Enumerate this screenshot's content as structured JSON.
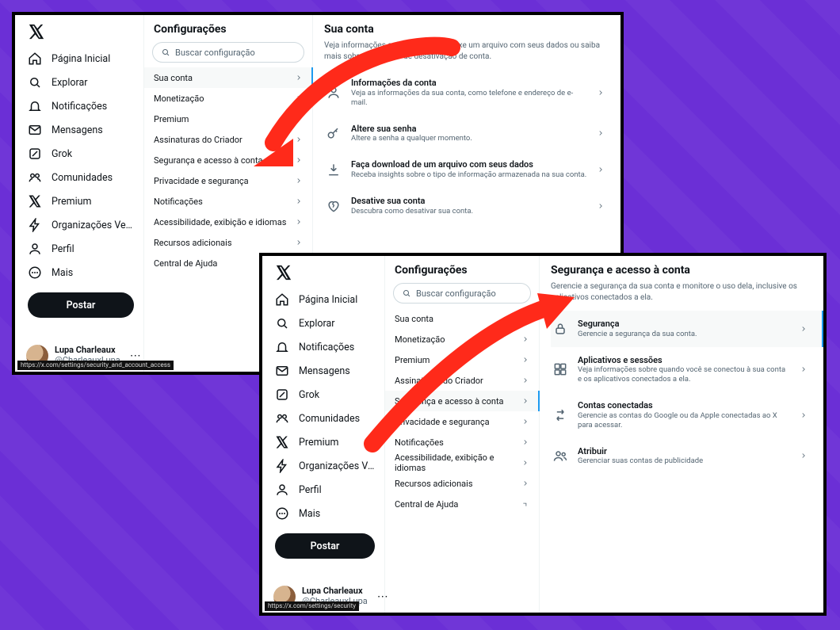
{
  "shared": {
    "nav": {
      "items": [
        {
          "id": "home",
          "label": "Página Inicial"
        },
        {
          "id": "explore",
          "label": "Explorar"
        },
        {
          "id": "notifications",
          "label": "Notificações"
        },
        {
          "id": "messages",
          "label": "Mensagens"
        },
        {
          "id": "grok",
          "label": "Grok"
        },
        {
          "id": "communities",
          "label": "Comunidades"
        },
        {
          "id": "premium",
          "label": "Premium"
        },
        {
          "id": "orgs",
          "label": "Organizações Verific"
        },
        {
          "id": "profile",
          "label": "Perfil"
        },
        {
          "id": "more",
          "label": "Mais"
        }
      ],
      "post_label": "Postar"
    },
    "profile": {
      "name": "Lupa Charleaux",
      "handle": "@CharleauxLupa"
    },
    "settings_header": "Configurações",
    "search_placeholder": "Buscar configuração",
    "settings_items": [
      {
        "id": "account",
        "label": "Sua conta"
      },
      {
        "id": "monetization",
        "label": "Monetização"
      },
      {
        "id": "premium",
        "label": "Premium"
      },
      {
        "id": "creator",
        "label": "Assinaturas do Criador"
      },
      {
        "id": "security",
        "label": "Segurança e acesso à conta"
      },
      {
        "id": "privacy",
        "label": "Privacidade e segurança"
      },
      {
        "id": "notif",
        "label": "Notificações"
      },
      {
        "id": "a11y",
        "label": "Acessibilidade, exibição e idiomas"
      },
      {
        "id": "extra",
        "label": "Recursos adicionais"
      },
      {
        "id": "help",
        "label": "Central de Ajuda",
        "ext": true
      }
    ]
  },
  "shot1": {
    "url": "https://x.com/settings/security_and_account_access",
    "active_setting": "account",
    "detail": {
      "title": "Sua conta",
      "subtitle": "Veja informações sobre sua conta, baixe um arquivo com seus dados ou saiba mais sobre as opções de desativação de conta.",
      "options": [
        {
          "id": "acctinfo",
          "title": "Informações da conta",
          "desc": "Veja as informações da sua conta, como telefone e endereço de e-mail."
        },
        {
          "id": "changepw",
          "title": "Altere sua senha",
          "desc": "Altere a senha a qualquer momento."
        },
        {
          "id": "download",
          "title": "Faça download de um arquivo com seus dados",
          "desc": "Receba insights sobre o tipo de informação armazenada na sua conta."
        },
        {
          "id": "deactivate",
          "title": "Desative sua conta",
          "desc": "Descubra como desativar sua conta."
        }
      ]
    }
  },
  "shot2": {
    "url": "https://x.com/settings/security",
    "active_setting": "security",
    "detail": {
      "title": "Segurança e acesso à conta",
      "subtitle": "Gerencie a segurança da sua conta e monitore o uso dela, inclusive os aplicativos conectados a ela.",
      "active_option": "security",
      "options": [
        {
          "id": "security",
          "title": "Segurança",
          "desc": "Gerencie a segurança da sua conta."
        },
        {
          "id": "apps_sessions",
          "title": "Aplicativos e sessões",
          "desc": "Veja informações sobre quando você se conectou à sua conta e os aplicativos conectados a ela."
        },
        {
          "id": "connected",
          "title": "Contas conectadas",
          "desc": "Gerencie as contas do Google ou da Apple conectadas ao X para acessar."
        },
        {
          "id": "delegate",
          "title": "Atribuir",
          "desc": "Gerenciar suas contas de publicidade"
        }
      ]
    }
  }
}
